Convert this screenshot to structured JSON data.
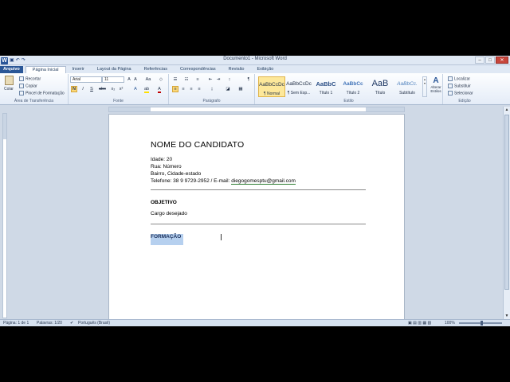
{
  "window": {
    "title": "Documento1 - Microsoft Word",
    "controls": [
      "–",
      "□",
      "✕"
    ]
  },
  "quick_access": {
    "logo": "W",
    "save_icon": "save-icon",
    "undo_icon": "undo-icon",
    "redo_icon": "redo-icon"
  },
  "tabs": [
    "Arquivo",
    "Página Inicial",
    "Inserir",
    "Layout da Página",
    "Referências",
    "Correspondências",
    "Revisão",
    "Exibição"
  ],
  "ribbon": {
    "clipboard": {
      "label": "Área de Transferência",
      "paste": "Colar",
      "cut": "Recortar",
      "copy": "Copiar",
      "format_painter": "Pincel de Formatação"
    },
    "font": {
      "label": "Fonte",
      "family": "Arial",
      "size": "11",
      "bold": "N",
      "italic": "I",
      "underline": "S"
    },
    "paragraph": {
      "label": "Parágrafo"
    },
    "styles": {
      "label": "Estilo",
      "items": [
        {
          "sample": "AaBbCcDc",
          "name": "¶ Normal"
        },
        {
          "sample": "AaBbCcDc",
          "name": "¶ Sem Esp..."
        },
        {
          "sample": "AaBbC",
          "name": "Título 1"
        },
        {
          "sample": "AaBbCc",
          "name": "Título 2"
        },
        {
          "sample": "AaB",
          "name": "Título"
        },
        {
          "sample": "AaBbCc.",
          "name": "Subtítulo"
        }
      ],
      "change_styles": "Alterar Estilos"
    },
    "editing": {
      "label": "Edição",
      "find": "Localizar",
      "replace": "Substituir",
      "select": "Selecionar"
    }
  },
  "document": {
    "name": "NOME DO CANDIDATO",
    "age": "Idade: 20",
    "street": "Rua: Número",
    "district": "Bairro, Cidade-estado",
    "phone_prefix": "Telefone: 38 9 9729-2952 / E-mail: ",
    "email": "diegogomesptu@gmail.com",
    "objective_heading": "OBJETIVO",
    "objective_text": "Cargo desejado",
    "education_heading": "FORMAÇÃO"
  },
  "status_bar": {
    "page": "Página: 1 de 1",
    "words": "Palavras: 1/20",
    "language": "Português (Brasil)",
    "zoom": "100%"
  },
  "colors": {
    "file_tab": "#2b5797",
    "selection": "#b6d0ef",
    "active_style": "#fde89a"
  }
}
